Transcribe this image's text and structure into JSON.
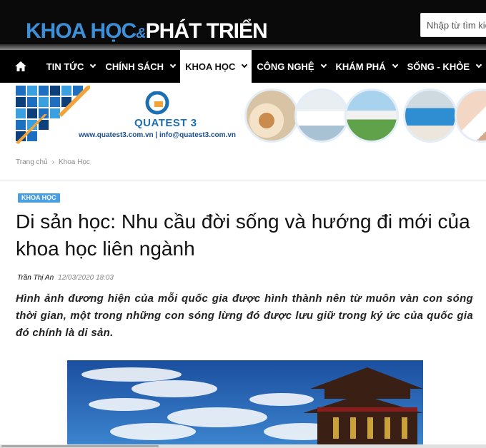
{
  "header": {
    "logo_part1": "KHOA HỌC",
    "logo_amp": "&",
    "logo_part2": "PHÁT TRIỂN",
    "search_placeholder": "Nhập từ tìm kiếm"
  },
  "nav": {
    "home_icon": "home-icon",
    "items": [
      {
        "label": "TIN TỨC",
        "has_dropdown": true
      },
      {
        "label": "CHÍNH SÁCH",
        "has_dropdown": true
      },
      {
        "label": "KHOA HỌC",
        "has_dropdown": true,
        "active": true
      },
      {
        "label": "CÔNG NGHỆ",
        "has_dropdown": true
      },
      {
        "label": "KHÁM PHÁ",
        "has_dropdown": true
      },
      {
        "label": "SỐNG - KHỎE",
        "has_dropdown": true
      }
    ]
  },
  "banner": {
    "brand": "QUATEST 3",
    "contact": "www.quatest3.com.vn | info@quatest3.com.vn"
  },
  "breadcrumb": {
    "home": "Trang chủ",
    "current": "Khoa Học"
  },
  "article": {
    "category": "KHOA HỌC",
    "title": "Di sản học: Nhu cầu đời sống và hướng đi mới của khoa học liên ngành",
    "author": "Trần Thị An",
    "date": "12/03/2020 18:03",
    "lead": "Hình ảnh đương hiện của mỗi quốc gia được hình thành nên từ muôn vàn con sóng thời gian, một trong những con sóng lừng đó được lưu giữ trong ký ức của quốc gia đó chính là di sản."
  },
  "colors": {
    "header_bg": "#0a0a0a",
    "logo_blue": "#3d8fd8",
    "badge_blue": "#4a9fe0",
    "nav_bg": "#000000"
  }
}
